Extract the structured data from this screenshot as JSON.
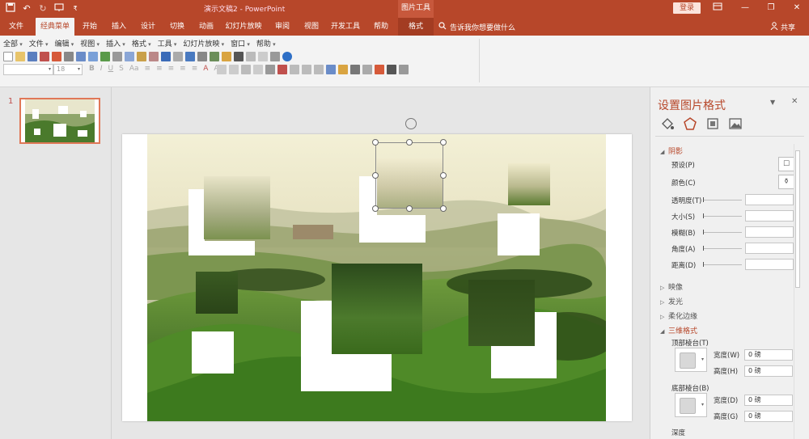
{
  "titlebar": {
    "doc_title": "演示文稿2  -  PowerPoint",
    "tool_context": "图片工具",
    "login_label": "登录"
  },
  "tabs": [
    {
      "label": "文件"
    },
    {
      "label": "经典菜单"
    },
    {
      "label": "开始"
    },
    {
      "label": "插入"
    },
    {
      "label": "设计"
    },
    {
      "label": "切换"
    },
    {
      "label": "动画"
    },
    {
      "label": "幻灯片放映"
    },
    {
      "label": "审阅"
    },
    {
      "label": "视图"
    },
    {
      "label": "开发工具"
    },
    {
      "label": "帮助"
    },
    {
      "label": "格式"
    }
  ],
  "tell_me": "告诉我你想要做什么",
  "share_label": "共享",
  "classic_menu": [
    "全部",
    "文件",
    "编辑",
    "视图",
    "插入",
    "格式",
    "工具",
    "幻灯片放映",
    "窗口",
    "帮助"
  ],
  "font_size_value": "18",
  "format_row": [
    "B",
    "I",
    "U",
    "S",
    "Aa",
    "≡",
    "≡",
    "≡",
    "≡",
    "≡",
    "A",
    "A"
  ],
  "thumbnail": {
    "number": "1"
  },
  "format_pane": {
    "title": "设置图片格式",
    "shadow_section": "阴影",
    "shadow_props": [
      "预设(P)",
      "颜色(C)",
      "透明度(T)",
      "大小(S)",
      "模糊(B)",
      "角度(A)",
      "距离(D)"
    ],
    "reflection_section": "映像",
    "glow_section": "发光",
    "soft_edge_section": "柔化边缘",
    "three_d_section": "三维格式",
    "top_bevel_label": "顶部棱台(T)",
    "bottom_bevel_label": "底部棱台(B)",
    "width_label": "宽度(W)",
    "height_label": "高度(H)",
    "width_label_b": "宽度(D)",
    "height_label_b": "高度(G)",
    "top_width_value": "0 磅",
    "top_height_value": "0 磅",
    "bottom_width_value": "0 磅",
    "bottom_height_value": "0 磅",
    "depth_label": "深度"
  },
  "colors": {
    "accent": "#b7472a",
    "ribbon_bg": "#f3f3f3",
    "pane_bg": "#f0f0f0"
  }
}
